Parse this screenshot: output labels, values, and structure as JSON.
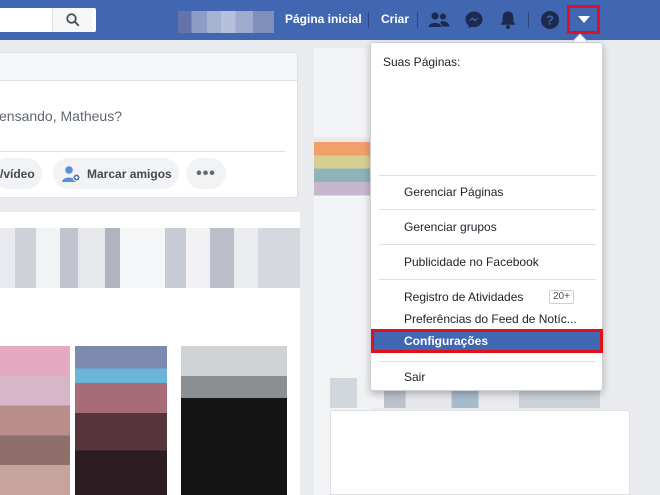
{
  "topbar": {
    "home_label": "Página inicial",
    "create_label": "Criar",
    "icons": [
      "search-icon",
      "friends-icon",
      "messenger-icon",
      "notifications-icon",
      "help-icon",
      "dropdown-caret-icon"
    ]
  },
  "composer": {
    "placeholder": "ensando, Matheus?",
    "buttons": {
      "video": "/vídeo",
      "tag_friends": "Marcar amigos",
      "more": "•••"
    }
  },
  "menu": {
    "section_title": "Suas Páginas:",
    "items": {
      "manage_pages": "Gerenciar Páginas",
      "manage_groups": "Gerenciar grupos",
      "advertising": "Publicidade no Facebook",
      "activity_log": "Registro de Atividades",
      "activity_log_badge": "20+",
      "feed_preferences": "Preferências do Feed de Notíc...",
      "settings": "Configurações",
      "logout": "Sair"
    }
  },
  "colors": {
    "brand_blue": "#4267b2",
    "highlight_red": "#e0111b",
    "background": "#e9ebee"
  }
}
